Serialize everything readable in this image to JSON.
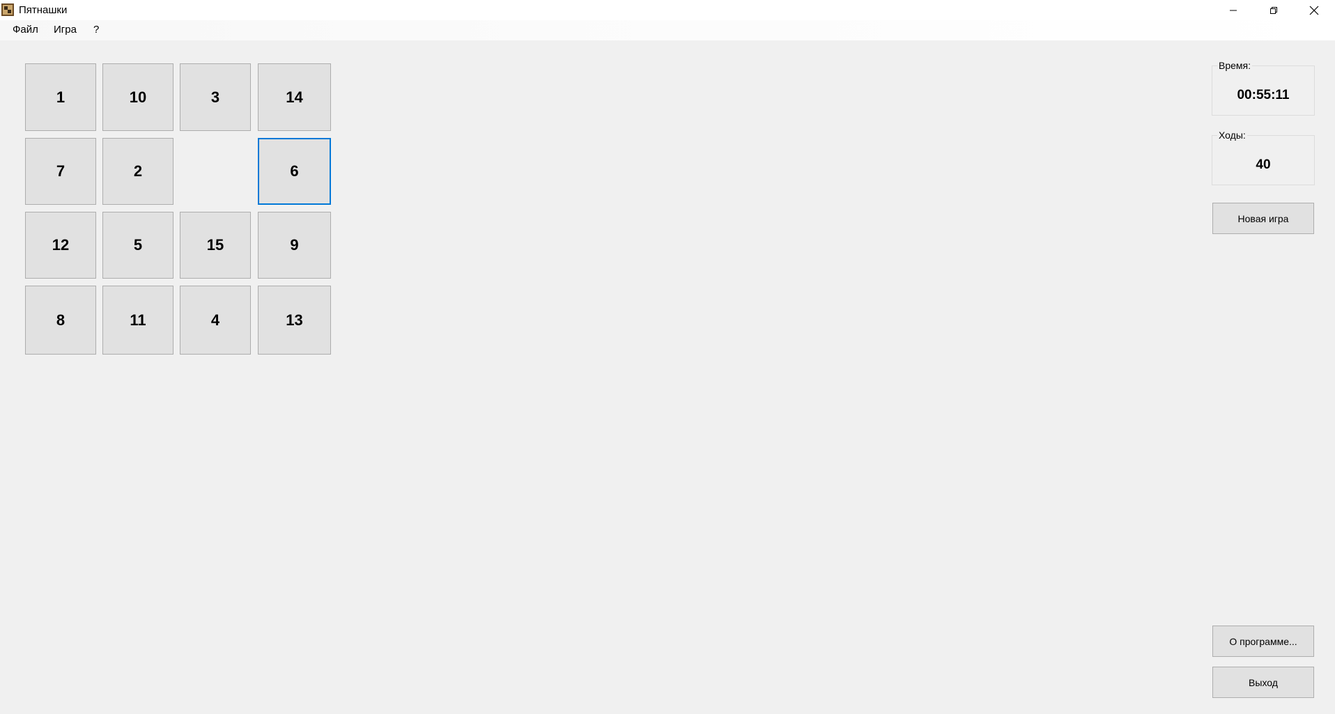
{
  "window": {
    "title": "Пятнашки",
    "minimize_icon": "minimize-icon",
    "maximize_icon": "restore-icon",
    "close_icon": "close-icon"
  },
  "menu": {
    "items": [
      "Файл",
      "Игра",
      "?"
    ]
  },
  "board": {
    "tiles": [
      [
        "1",
        "10",
        "3",
        "14"
      ],
      [
        "7",
        "2",
        "",
        "6"
      ],
      [
        "12",
        "5",
        "15",
        "9"
      ],
      [
        "8",
        "11",
        "4",
        "13"
      ]
    ],
    "selected_tile": "6"
  },
  "time_group": {
    "label": "Время:",
    "value": "00:55:11"
  },
  "moves_group": {
    "label": "Ходы:",
    "value": "40"
  },
  "buttons": {
    "new_game": "Новая игра",
    "about": "О программе...",
    "exit": "Выход"
  },
  "colors": {
    "background": "#f0f0f0",
    "tile": "#e1e1e1",
    "focus_accent": "#0078d7"
  }
}
